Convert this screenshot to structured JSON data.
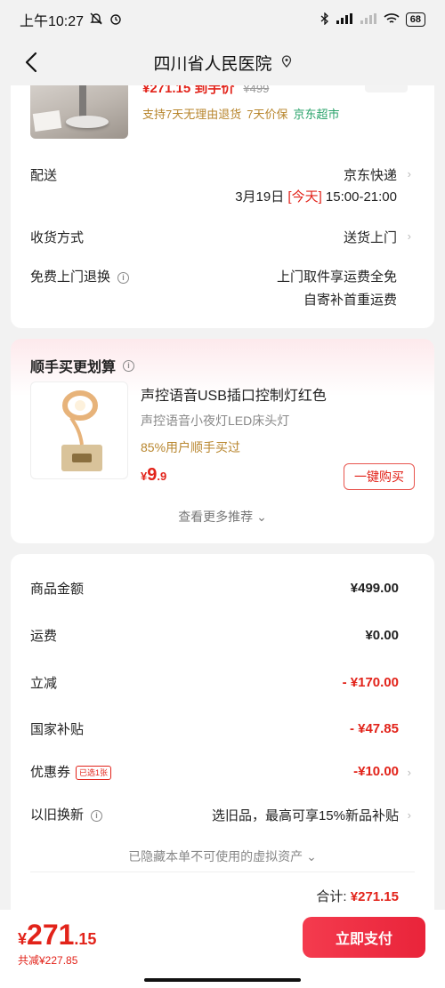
{
  "status_bar": {
    "time": "上午10:27",
    "battery": "68"
  },
  "nav": {
    "title": "四川省人民医院"
  },
  "product": {
    "price_partial": "¥271.15 到手价",
    "orig_price_partial": "¥499",
    "services": [
      "支持7天无理由退货",
      "7天价保"
    ],
    "store_tag": "京东超市"
  },
  "delivery": {
    "label": "配送",
    "carrier": "京东快递",
    "date": "3月19日",
    "today": "[今天]",
    "time_window": "15:00-21:00"
  },
  "receive": {
    "label": "收货方式",
    "value": "送货上门"
  },
  "returns": {
    "label": "免费上门退换",
    "line1": "上门取件享运费全免",
    "line2": "自寄补首重运费"
  },
  "recommend": {
    "title": "顺手买更划算",
    "name": "声控语音USB插口控制灯红色",
    "subtitle": "声控语音小夜灯LED床头灯",
    "buyers": "85%用户顺手买过",
    "price_symbol": "¥",
    "price_int": "9",
    "price_dec": ".9",
    "buy_label": "一键购买",
    "more": "查看更多推荐"
  },
  "summary": {
    "rows": [
      {
        "label": "商品金额",
        "value": "¥499.00"
      },
      {
        "label": "运费",
        "value": "¥0.00"
      },
      {
        "label": "立减",
        "value": "- ¥170.00"
      },
      {
        "label": "国家补贴",
        "value": "- ¥47.85"
      },
      {
        "label": "优惠券",
        "value": "-¥10.00",
        "badge": "已选1张"
      },
      {
        "label": "以旧换新",
        "value": "选旧品，最高可享15%新品补贴"
      }
    ],
    "hidden_note": "已隐藏本单不可使用的虚拟资产",
    "total_label": "合计:",
    "total_value": "¥271.15"
  },
  "footer": {
    "symbol": "¥",
    "int": "271",
    "dec": ".15",
    "saved": "共减¥227.85",
    "pay_label": "立即支付"
  },
  "colors": {
    "accent": "#e2231a",
    "gold": "#b8862e",
    "jd_green": "#2aa36b"
  }
}
